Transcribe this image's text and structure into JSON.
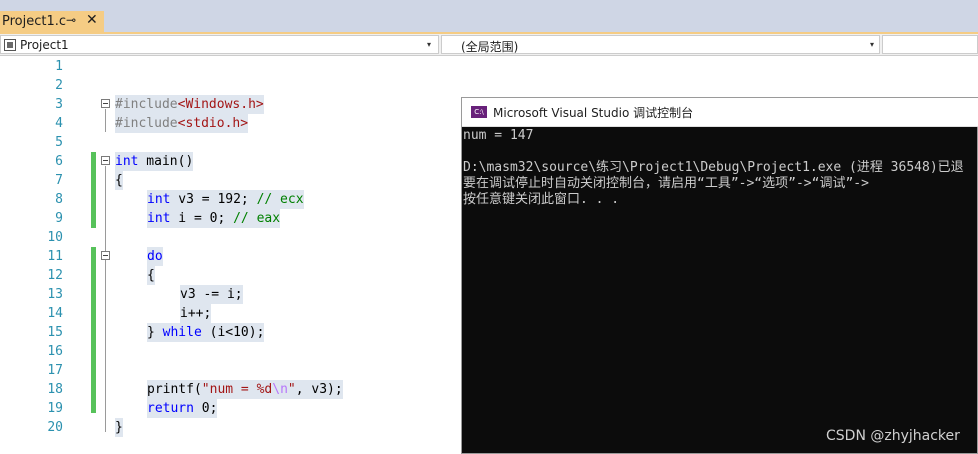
{
  "tab": {
    "label": "Project1.c",
    "pin_glyph": "⊸",
    "close_glyph": "✕"
  },
  "navbar": {
    "project": "Project1",
    "scope": "(全局范围)",
    "arrow": "▾"
  },
  "editor": {
    "lines": [
      {
        "num": "1"
      },
      {
        "num": "2"
      },
      {
        "num": "3"
      },
      {
        "num": "4"
      },
      {
        "num": "5"
      },
      {
        "num": "6"
      },
      {
        "num": "7"
      },
      {
        "num": "8"
      },
      {
        "num": "9"
      },
      {
        "num": "10"
      },
      {
        "num": "11"
      },
      {
        "num": "12"
      },
      {
        "num": "13"
      },
      {
        "num": "14"
      },
      {
        "num": "15"
      },
      {
        "num": "16"
      },
      {
        "num": "17"
      },
      {
        "num": "18"
      },
      {
        "num": "19"
      },
      {
        "num": "20"
      }
    ],
    "code": {
      "l3_pp": "#include",
      "l3_hdr": "<Windows.h>",
      "l4_pp": "#include",
      "l4_hdr": "<stdio.h>",
      "l6_kw": "int",
      "l6_rest": " main()",
      "l7": "{",
      "l8_kw": "int",
      "l8_rest": " v3 = 192; ",
      "l8_cmt": "// ecx",
      "l9_kw": "int",
      "l9_rest": " i = 0; ",
      "l9_cmt": "// eax",
      "l11_kw": "do",
      "l12": "{",
      "l13": "v3 -= i;",
      "l14": "i++;",
      "l15_a": "} ",
      "l15_kw": "while",
      "l15_b": " (i<10);",
      "l18_a": "printf(",
      "l18_s1": "\"num = %d",
      "l18_esc": "\\n",
      "l18_s2": "\"",
      "l18_b": ", v3);",
      "l19_kw": "return",
      "l19_rest": " 0;",
      "l20": "}"
    }
  },
  "console": {
    "icon_text": "C:\\",
    "title": "Microsoft Visual Studio 调试控制台",
    "lines": [
      "num = 147",
      "",
      "D:\\masm32\\source\\练习\\Project1\\Debug\\Project1.exe (进程 36548)已退",
      "要在调试停止时自动关闭控制台，请启用“工具”->“选项”->“调试”->",
      "按任意键关闭此窗口. . ."
    ]
  },
  "watermark": "CSDN @zhyjhacker"
}
